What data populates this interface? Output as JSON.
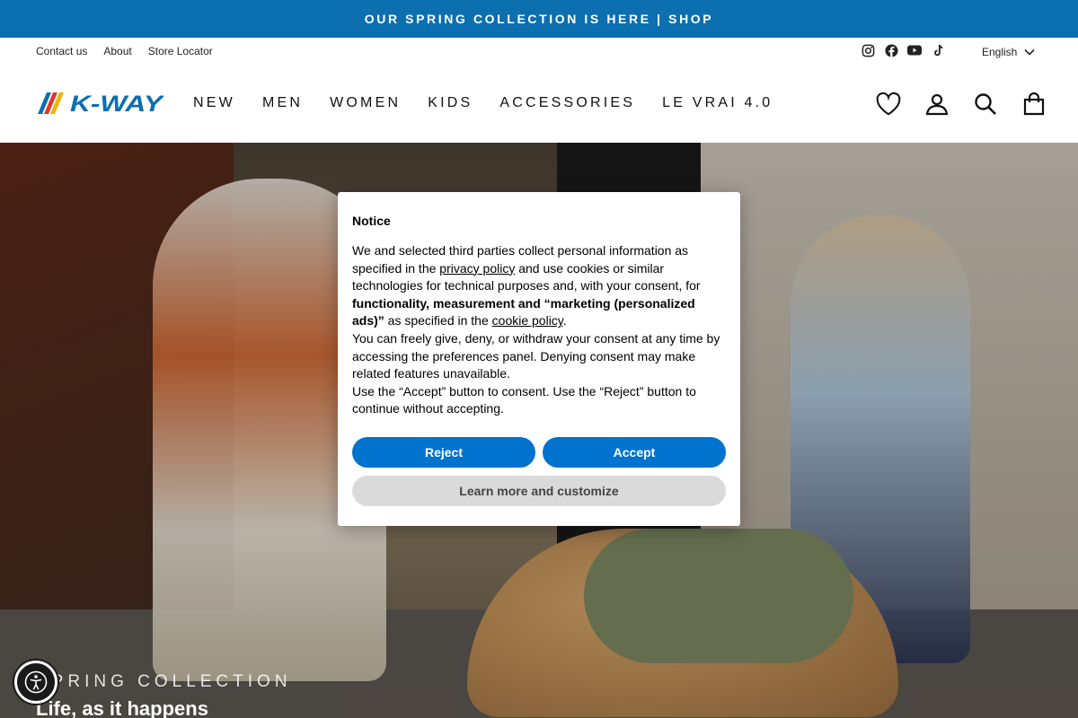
{
  "announcement": "OUR SPRING COLLECTION IS HERE | SHOP",
  "utility_links": [
    "Contact us",
    "About",
    "Store Locator"
  ],
  "socials": [
    "instagram-icon",
    "facebook-icon",
    "youtube-icon",
    "tiktok-icon"
  ],
  "language": "English",
  "brand": "K-WAY",
  "nav": [
    "NEW",
    "MEN",
    "WOMEN",
    "KIDS",
    "ACCESSORIES",
    "LE VRAI 4.0"
  ],
  "header_icons": [
    "wishlist-heart-icon",
    "account-icon",
    "search-icon",
    "cart-icon"
  ],
  "hero": {
    "kicker": "SPRING COLLECTION",
    "title": "Life, as it happens"
  },
  "consent": {
    "title": "Notice",
    "p1_a": "We and selected third parties collect personal information as specified in the ",
    "p1_link": "privacy policy",
    "p1_b": " and use cookies or similar technologies for technical purposes and, with your consent, for ",
    "p1_bold": "functionality, measurement and “marketing (personalized ads)”",
    "p1_c": " as specified in the ",
    "p1_link2": "cookie policy",
    "p1_d": ".",
    "p2": "You can freely give, deny, or withdraw your consent at any time by accessing the preferences panel. Denying consent may make related features unavailable.",
    "p3": "Use the “Accept” button to consent. Use the “Reject” button to continue without accepting.",
    "reject": "Reject",
    "accept": "Accept",
    "learn": "Learn more and customize"
  },
  "colors": {
    "brand_blue": "#0b6fb0",
    "button_blue": "#0073ce"
  }
}
